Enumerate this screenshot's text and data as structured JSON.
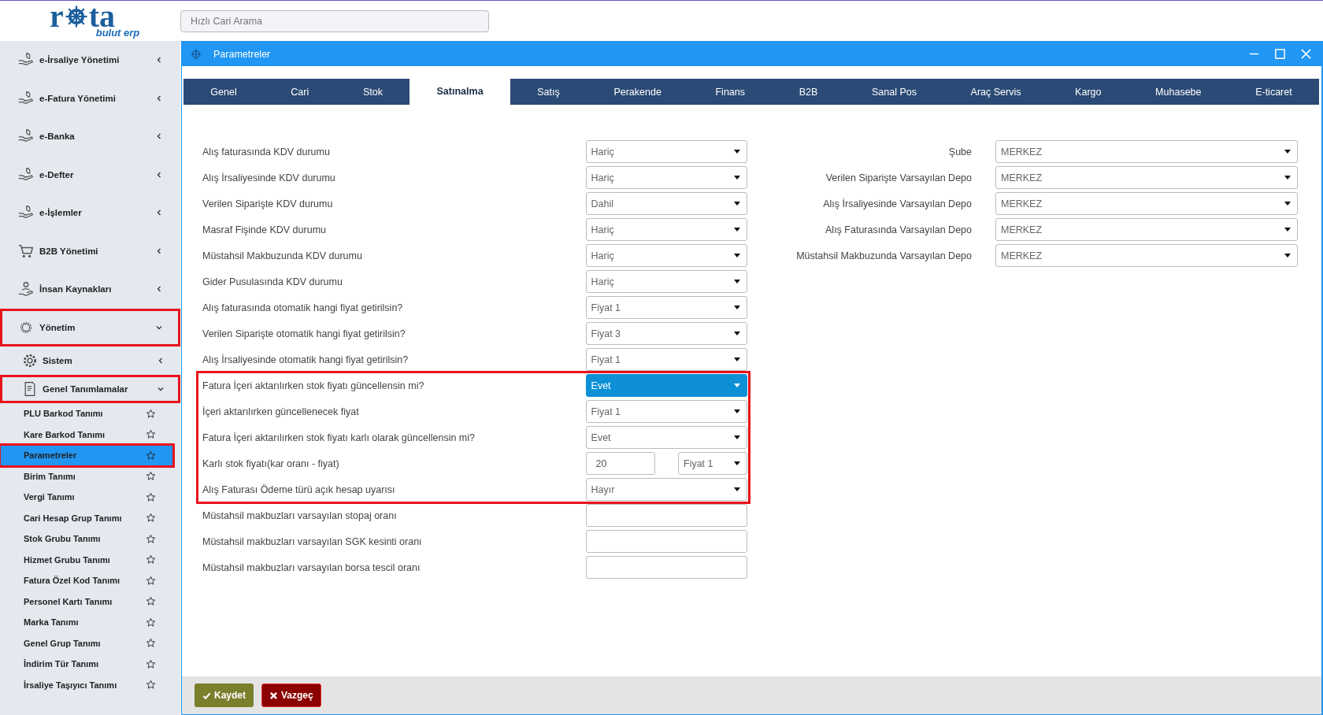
{
  "logo": {
    "text_before": "r",
    "text_after": "ta",
    "subtitle": "bulut erp"
  },
  "search": {
    "placeholder": "Hızlı Cari Arama"
  },
  "sidebar": {
    "items": [
      {
        "label": "e-İrsaliye Yönetimi",
        "expanded": false,
        "highlighted": false
      },
      {
        "label": "e-Fatura Yönetimi",
        "expanded": false,
        "highlighted": false
      },
      {
        "label": "e-Banka",
        "expanded": false,
        "highlighted": false
      },
      {
        "label": "e-Defter",
        "expanded": false,
        "highlighted": false
      },
      {
        "label": "e-İşlemler",
        "expanded": false,
        "highlighted": false
      },
      {
        "label": "B2B Yönetimi",
        "expanded": false,
        "highlighted": false
      },
      {
        "label": "İnsan Kaynakları",
        "expanded": false,
        "highlighted": false
      },
      {
        "label": "Yönetim",
        "expanded": true,
        "highlighted": true,
        "children": [
          {
            "label": "Sistem",
            "expanded": false,
            "highlighted": false
          },
          {
            "label": "Genel Tanımlamalar",
            "expanded": true,
            "highlighted": true,
            "children": [
              {
                "label": "PLU Barkod Tanımı",
                "selected": false
              },
              {
                "label": "Kare Barkod Tanımı",
                "selected": false
              },
              {
                "label": "Parametreler",
                "selected": true
              },
              {
                "label": "Birim Tanımı",
                "selected": false
              },
              {
                "label": "Vergi Tanımı",
                "selected": false
              },
              {
                "label": "Cari Hesap Grup Tanımı",
                "selected": false
              },
              {
                "label": "Stok Grubu Tanımı",
                "selected": false
              },
              {
                "label": "Hizmet Grubu Tanımı",
                "selected": false
              },
              {
                "label": "Fatura Özel Kod Tanımı",
                "selected": false
              },
              {
                "label": "Personel Kartı Tanımı",
                "selected": false
              },
              {
                "label": "Marka Tanımı",
                "selected": false
              },
              {
                "label": "Genel Grup Tanımı",
                "selected": false
              },
              {
                "label": "İndirim Tür Tanımı",
                "selected": false
              },
              {
                "label": "İrsaliye Taşıyıcı Tanımı",
                "selected": false
              }
            ]
          }
        ]
      }
    ]
  },
  "window": {
    "title": "Parametreler"
  },
  "tabs": [
    {
      "label": "Genel",
      "selected": false
    },
    {
      "label": "Cari",
      "selected": false
    },
    {
      "label": "Stok",
      "selected": false
    },
    {
      "label": "Satınalma",
      "selected": true
    },
    {
      "label": "Satış",
      "selected": false
    },
    {
      "label": "Perakende",
      "selected": false
    },
    {
      "label": "Finans",
      "selected": false
    },
    {
      "label": "B2B",
      "selected": false
    },
    {
      "label": "Sanal Pos",
      "selected": false
    },
    {
      "label": "Araç Servis",
      "selected": false
    },
    {
      "label": "Kargo",
      "selected": false
    },
    {
      "label": "Muhasebe",
      "selected": false
    },
    {
      "label": "E-ticaret",
      "selected": false
    }
  ],
  "left_sections": [
    {
      "highlighted": false,
      "rows": [
        {
          "kind": "select",
          "label": "Alış faturasında KDV durumu",
          "value": "Hariç",
          "focused": false
        },
        {
          "kind": "select",
          "label": "Alış İrsaliyesinde KDV durumu",
          "value": "Hariç",
          "focused": false
        },
        {
          "kind": "select",
          "label": "Verilen Siparişte KDV durumu",
          "value": "Dahil",
          "focused": false
        },
        {
          "kind": "select",
          "label": "Masraf Fişinde KDV durumu",
          "value": "Hariç",
          "focused": false
        },
        {
          "kind": "select",
          "label": "Müstahsil Makbuzunda KDV durumu",
          "value": "Hariç",
          "focused": false
        },
        {
          "kind": "select",
          "label": "Gider Pusulasında KDV durumu",
          "value": "Hariç",
          "focused": false
        },
        {
          "kind": "select",
          "label": "Alış faturasında otomatik hangi fiyat getirilsin?",
          "value": "Fiyat 1",
          "focused": false
        },
        {
          "kind": "select",
          "label": "Verilen Siparişte otomatik hangi fiyat getirilsin?",
          "value": "Fiyat 3",
          "focused": false
        },
        {
          "kind": "select",
          "label": "Alış İrsaliyesinde otomatik hangi fiyat getirilsin?",
          "value": "Fiyat 1",
          "focused": false
        }
      ]
    },
    {
      "highlighted": true,
      "rows": [
        {
          "kind": "select",
          "label": "Fatura İçeri aktarılırken stok fiyatı güncellensin mi?",
          "value": "Evet",
          "focused": true
        },
        {
          "kind": "select",
          "label": "İçeri aktarılırken güncellenecek fiyat",
          "value": "Fiyat 1",
          "focused": false
        },
        {
          "kind": "select",
          "label": "Fatura İçeri aktarılırken stok fiyatı karlı olarak güncellensin mi?",
          "value": "Evet",
          "focused": false
        },
        {
          "kind": "input_select",
          "label": "Karlı stok fiyatı(kar oranı - fiyat)",
          "input": "20",
          "value": "Fiyat 1",
          "focused": false
        },
        {
          "kind": "select",
          "label": "Alış Faturası Ödeme türü açık hesap uyarısı",
          "value": "Hayır",
          "focused": false
        }
      ]
    },
    {
      "highlighted": false,
      "rows": [
        {
          "kind": "input",
          "label": "Müstahsil makbuzları varsayılan stopaj oranı"
        },
        {
          "kind": "input",
          "label": "Müstahsil makbuzları varsayılan SGK kesinti oranı"
        },
        {
          "kind": "input",
          "label": "Müstahsil makbuzları varsayılan borsa tescil oranı"
        }
      ]
    }
  ],
  "right_rows": [
    {
      "label": "Şube",
      "value": "MERKEZ"
    },
    {
      "label": "Verilen Siparişte Varsayılan Depo",
      "value": "MERKEZ"
    },
    {
      "label": "Alış İrsaliyesinde Varsayılan Depo",
      "value": "MERKEZ"
    },
    {
      "label": "Alış Faturasında Varsayılan Depo",
      "value": "MERKEZ"
    },
    {
      "label": "Müstahsil Makbuzunda Varsayılan Depo",
      "value": "MERKEZ"
    }
  ],
  "buttons": [
    {
      "kind": "save",
      "label": "Kaydet"
    },
    {
      "kind": "cancel",
      "label": "Vazgeç"
    }
  ]
}
